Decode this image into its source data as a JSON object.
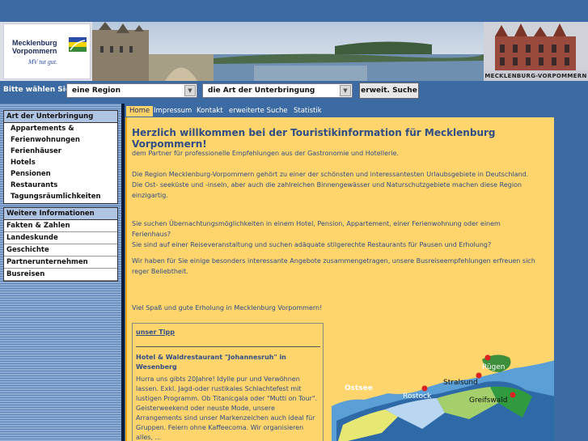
{
  "banner": {
    "logo_line1": "Mecklenburg",
    "logo_line2": "Vorpommern",
    "logo_slogan": "MV tut gut.",
    "title": "MECKLENBURG-VORPOMMERN"
  },
  "search": {
    "label": "Bitte wählen Sie",
    "region_select": "eine Region",
    "type_select": "die Art der Unterbringung",
    "button": "erweit. Suche"
  },
  "sidebar": {
    "box1": {
      "heading": "Art der Unterbringung",
      "items": [
        "Appartements &",
        "Ferienwohnungen",
        "Ferienhäuser",
        "Hotels",
        "Pensionen",
        "Restaurants",
        "Tagungsräumlichkeiten"
      ]
    },
    "box2": {
      "heading": "Weitere Informationen",
      "items": [
        "Fakten & Zahlen",
        "Landeskunde",
        "Geschichte",
        "Partnerunternehmen",
        "Busreisen"
      ]
    }
  },
  "nav": {
    "items": [
      "Home",
      "Impressum",
      "Kontakt",
      "erweiterte Suche",
      "Statistik"
    ]
  },
  "content": {
    "headline": "Herzlich willkommen bei der Touristikinformation für Mecklenburg Vorpommern!",
    "p1": "dem Partner für professionelle Empfehlungen aus der Gastronomie und Hotellerie.",
    "p2a": "Die Region Mecklenburg-Vorpommern gehört zu einer der schönsten und interessantesten Urlaubsgebiete in Deutschland.",
    "p2b": "Die Ost- seeküste und -inseln, aber auch die zahlreichen Binnengewässer und Naturschutzgebiete machen diese Region",
    "p2c": "einzigartig.",
    "p3a": "Sie suchen Übernachtungsmöglichkeiten in einem Hotel, Pension, Appartement, einer Ferienwohnung oder einem",
    "p3b": "Ferienhaus?",
    "p3c": "Sie sind auf einer Reiseveranstaltung und suchen adäquate stilgerechte Restaurants für Pausen und Erholung?",
    "p4a": "Wir haben für Sie einige besonders interessante Angebote zusammengetragen, unsere Busreiseempfehlungen erfreuen sich",
    "p4b": "reger Beliebtheit.",
    "p5": "Viel Spaß und gute Erholung in Mecklenburg Vorpommern!"
  },
  "tip": {
    "label": "unser Tipp",
    "title": "Hotel & Waldrestaurant \"Johannesruh\" in Wesenberg",
    "body": "Hurra uns gibts 20Jahre! Idylle pur und Verwöhnen lassen. Exkl. Jagd-oder rustikales Schlachtefest mit lustigen Programm. Ob Titanicgala oder \"Mutti on Tour\". Geisterweekend oder neuste Mode, unsere Arrangements sind unser Markenzeichen auch ideal für Gruppen. Feiern ohne Kaffeecoma. Wir organisieren alles, ..."
  },
  "map": {
    "sea_label": "Ostsee",
    "cities": [
      "Rügen",
      "Stralsund",
      "Rostock",
      "Greifswald"
    ]
  }
}
